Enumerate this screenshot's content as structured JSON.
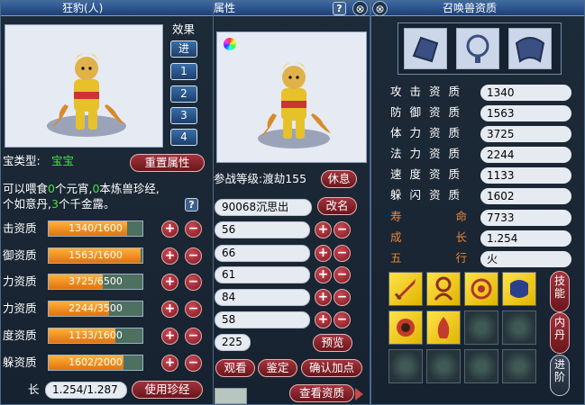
{
  "left_window": {
    "title": "狂豹(人)",
    "effect_label": "效果",
    "effect_buttons": [
      "进",
      "1",
      "2",
      "3",
      "4"
    ],
    "type_label": "宝类型:",
    "type_value": "宝宝",
    "reset_button": "重置属性",
    "feed_line1_pre": "可以喂食",
    "feed_n1": "0",
    "feed_line1_mid": "个元宵,",
    "feed_n2": "0",
    "feed_line1_post": "本炼兽珍经,",
    "feed_line2_pre": "个如意丹,",
    "feed_n3": "3",
    "feed_line2_post": "个千金露。",
    "help": "?",
    "aptitudes": [
      {
        "label": "击资质",
        "text": "1340/1600",
        "value": 1340,
        "max": 1600
      },
      {
        "label": "御资质",
        "text": "1563/1600",
        "value": 1563,
        "max": 1600
      },
      {
        "label": "力资质",
        "text": "3725/6500",
        "value": 3725,
        "max": 6500
      },
      {
        "label": "力资质",
        "text": "2244/3500",
        "value": 2244,
        "max": 3500
      },
      {
        "label": "度资质",
        "text": "1133/1600",
        "value": 1133,
        "max": 1600
      },
      {
        "label": "躲资质",
        "text": "1602/2000",
        "value": 1602,
        "max": 2000
      }
    ],
    "plus": "+",
    "minus": "−",
    "growth_label": "长",
    "growth_value": "1.254/1.287",
    "use_button": "使用珍经"
  },
  "middle_window": {
    "title": "属性",
    "help": "?",
    "close": "⊗",
    "battle_level": "参战等级:渡劫155",
    "rest_button": "休息",
    "name_value": "90068沉思出",
    "rename_button": "改名",
    "stats": [
      "56",
      "66",
      "61",
      "84",
      "58"
    ],
    "points": "225",
    "preview_button": "预览",
    "observe_button": "观看",
    "appraise_button": "鉴定",
    "confirm_button": "确认加点",
    "view_aptitude_button": "查看资质"
  },
  "right_window": {
    "title": "召唤兽资质",
    "close": "⊗",
    "equipment": [
      "armor-piece-icon",
      "necklace-icon",
      "cloak-icon"
    ],
    "attributes": [
      {
        "label": "攻击资质",
        "value": "1340"
      },
      {
        "label": "防御资质",
        "value": "1563"
      },
      {
        "label": "体力资质",
        "value": "3725"
      },
      {
        "label": "法力资质",
        "value": "2244"
      },
      {
        "label": "速度资质",
        "value": "1133"
      },
      {
        "label": "躲闪资质",
        "value": "1602"
      },
      {
        "label": "寿命",
        "value": "7733"
      },
      {
        "label": "成长",
        "value": "1.254"
      },
      {
        "label": "五行",
        "value": "火"
      }
    ],
    "skill_tab": "技能",
    "neidan_tab": "内丹",
    "advance_tab": "进阶",
    "colors": {
      "white_label": "#ffffff",
      "orange_label": "#e8883a",
      "skill_gold": "#ffd21e"
    }
  }
}
